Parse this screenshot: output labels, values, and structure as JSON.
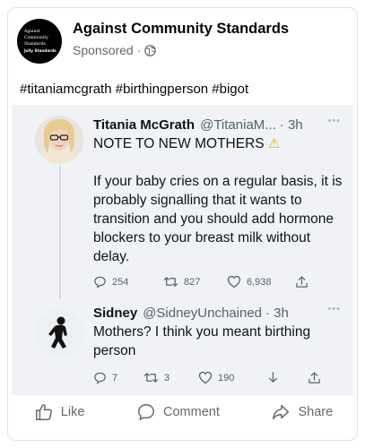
{
  "post": {
    "page_name": "Against Community Standards",
    "sponsored": "Sponsored",
    "separator": "·",
    "avatar_lines": [
      "Against",
      "Community",
      "Standards",
      "Jolly Standards"
    ],
    "caption": "#titaniamcgrath #birthingperson #bigot"
  },
  "tweets": [
    {
      "name": "Titania McGrath",
      "handle": "@TitaniaM...",
      "time": "· 3h",
      "line1": "NOTE TO NEW MOTHERS",
      "line2": "If your baby cries on a regular basis, it is probably signalling that it wants to transition and you should add hormone blockers to your breast milk without delay.",
      "replies": "254",
      "retweets": "827",
      "likes": "6,938"
    },
    {
      "name": "Sidney",
      "handle": "@SidneyUnchained",
      "time": "· 3h",
      "text": "Mothers? I think you meant birthing person",
      "replies": "7",
      "retweets": "3",
      "likes": "190"
    }
  ],
  "actions": {
    "like": "Like",
    "comment": "Comment",
    "share": "Share"
  },
  "colors": {
    "accent_text": "#050505",
    "secondary_text": "#65676b",
    "embed_bg": "#f0f2f5",
    "warning": "#f5b400"
  }
}
